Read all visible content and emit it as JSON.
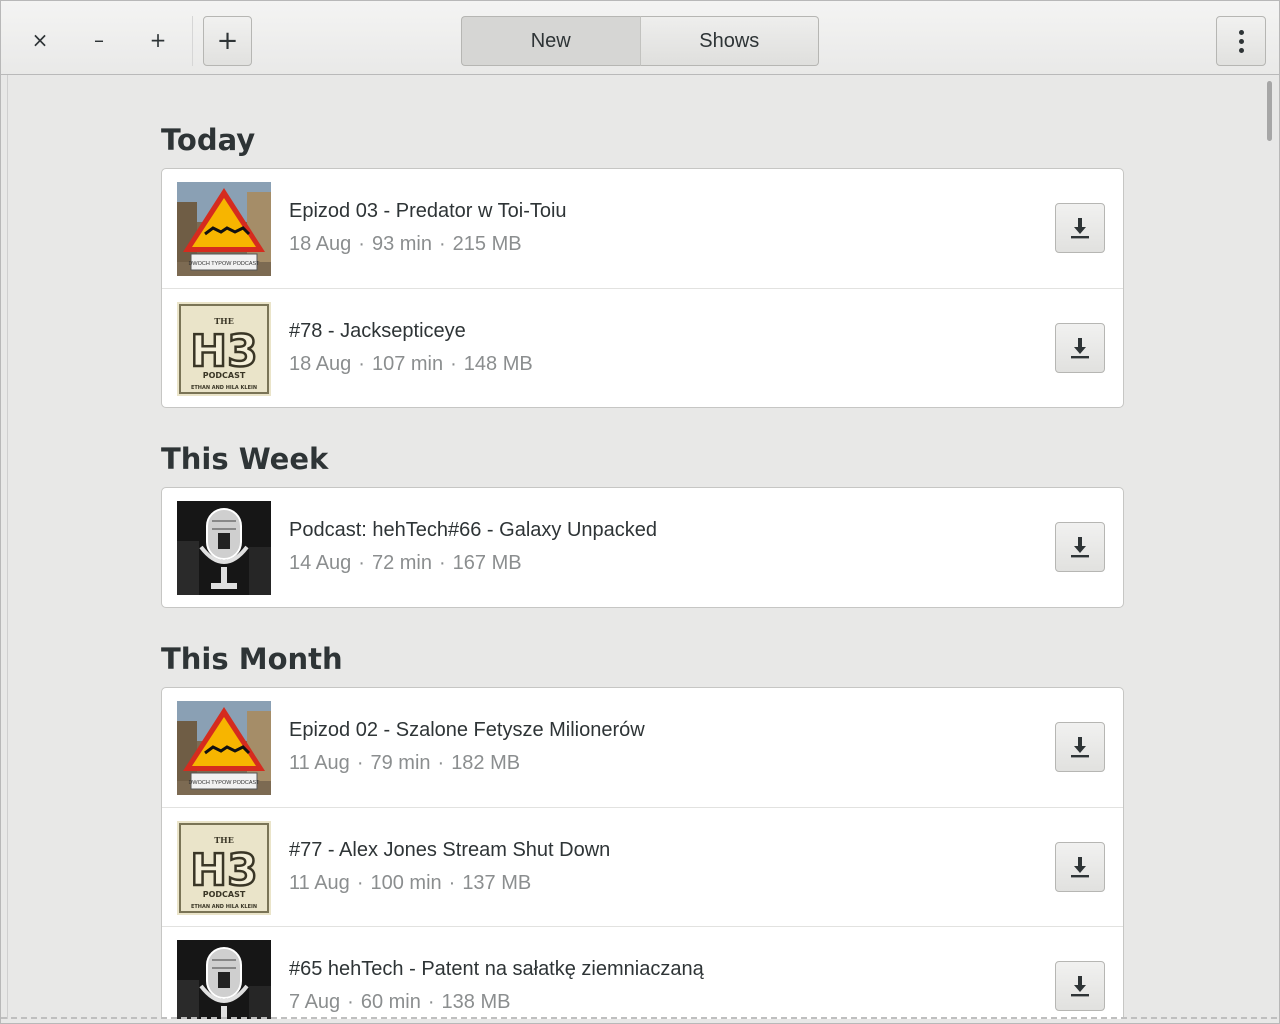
{
  "header": {
    "close_glyph": "×",
    "minimize_glyph": "–",
    "maximize_glyph": "+",
    "add_glyph": "+",
    "tabs": [
      {
        "label": "New",
        "active": true
      },
      {
        "label": "Shows",
        "active": false
      }
    ],
    "menu_icon": "vertical-dots-icon"
  },
  "sections": [
    {
      "title": "Today",
      "episodes": [
        {
          "title": "Epizod 03 - Predator w Toi-Toiu",
          "date": "18 Aug",
          "duration": "93 min",
          "size": "215 MB",
          "art": "dwoch-typow-art"
        },
        {
          "title": "#78 - Jacksepticeye",
          "date": "18 Aug",
          "duration": "107 min",
          "size": "148 MB",
          "art": "h3-podcast-art"
        }
      ]
    },
    {
      "title": "This Week",
      "episodes": [
        {
          "title": "Podcast: hehTech#66 - Galaxy Unpacked",
          "date": "14 Aug",
          "duration": "72 min",
          "size": "167 MB",
          "art": "hehtech-art"
        }
      ]
    },
    {
      "title": "This Month",
      "episodes": [
        {
          "title": "Epizod 02 - Szalone Fetysze Milionerów",
          "date": "11 Aug",
          "duration": "79 min",
          "size": "182 MB",
          "art": "dwoch-typow-art"
        },
        {
          "title": "#77 - Alex Jones Stream Shut Down",
          "date": "11 Aug",
          "duration": "100 min",
          "size": "137 MB",
          "art": "h3-podcast-art"
        },
        {
          "title": "#65 hehTech - Patent na sałatkę ziemniaczaną",
          "date": "7 Aug",
          "duration": "60 min",
          "size": "138 MB",
          "art": "hehtech-art"
        }
      ]
    }
  ],
  "art_text": {
    "dwoch_typow": "DWOCH TYPOW PODCAST",
    "h3": "H3",
    "h3_the": "THE",
    "h3_podcast": "PODCAST",
    "h3_hosts": "ETHAN AND HILA KLEIN"
  },
  "separator": "·",
  "colors": {
    "background": "#e8e8e7",
    "card": "#ffffff",
    "text": "#2e3436",
    "meta_text": "#8b8e8f"
  }
}
